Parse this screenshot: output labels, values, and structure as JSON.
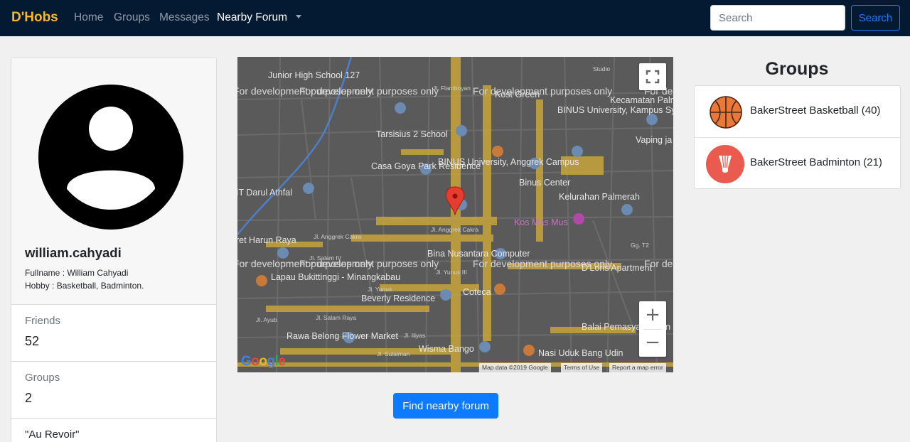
{
  "navbar": {
    "brand": "D'Hobs",
    "links": [
      {
        "label": "Home",
        "active": false
      },
      {
        "label": "Groups",
        "active": false
      },
      {
        "label": "Messages",
        "active": false
      },
      {
        "label": "Nearby Forum",
        "active": true
      }
    ],
    "search": {
      "placeholder": "Search",
      "value": ""
    },
    "search_button": "Search"
  },
  "profile": {
    "username": "william.cahyadi",
    "fullname": "Fullname : William Cahyadi",
    "hobby": "Hobby : Basketball, Badminton.",
    "avatar_icon": "user-circle-icon",
    "stats": [
      {
        "label": "Friends",
        "value": "52"
      },
      {
        "label": "Groups",
        "value": "2"
      }
    ],
    "quote": "\"Au Revoir\""
  },
  "map": {
    "dev_watermark": "For development purposes only",
    "labels": [
      "Junior High School 127",
      "Tarsisius 2 School",
      "Casa Goya Park Residence",
      "BINUS University, Anggrek Campus",
      "Binus Center",
      "BINUS University, Kampus Syahdan",
      "Kecamatan Palmerah",
      "Vaping ja",
      "Kelurahan Palmerah",
      "Kos Mas Mus",
      "IT Darul Athfal",
      "ret Harun Raya",
      "Bina Nusantara Computer",
      "Lapau Bukittinggi - Minangkabau",
      "Beverly Residence",
      "Coteca",
      "D'Loris Apartment",
      "Balai Pemasyarakatan (BAPAS) Kelas",
      "Rawa Belong Flower Market",
      "Wisma Bango",
      "Nasi Uduk Bang Udin",
      "Jl. Anggrek Cakra",
      "Jl. Salam IV",
      "Jl. Yunus III",
      "Jl. Yunus",
      "Jl. Ayub",
      "Jl. Salam Raya",
      "Jl. Sulaiman",
      "Jl. Iliyas",
      "Jl. Flamboyan",
      "Gg. T2",
      "Studio",
      "Kost Green",
      "Jl. Palmerah Barat VI"
    ],
    "logo": [
      "G",
      "o",
      "o",
      "g",
      "l",
      "e"
    ],
    "attribution": [
      "Map data ©2019 Google",
      "Terms of Use",
      "Report a map error"
    ],
    "zoom_in": "+",
    "zoom_out": "−",
    "fullscreen_icon": "fullscreen-icon",
    "marker_icon": "map-pin-icon"
  },
  "find_button": "Find nearby forum",
  "groups": {
    "title": "Groups",
    "items": [
      {
        "label": "BakerStreet Basketball (40)",
        "icon": "basketball-icon",
        "color": "#e8793a"
      },
      {
        "label": "BakerStreet Badminton (21)",
        "icon": "shuttlecock-icon",
        "color": "#ea5a4f"
      }
    ]
  },
  "colors": {
    "navbar": "#041a33",
    "brand": "#f5b82e",
    "primary": "#0d7bff",
    "map_road_yellow": "#c8a63c"
  }
}
